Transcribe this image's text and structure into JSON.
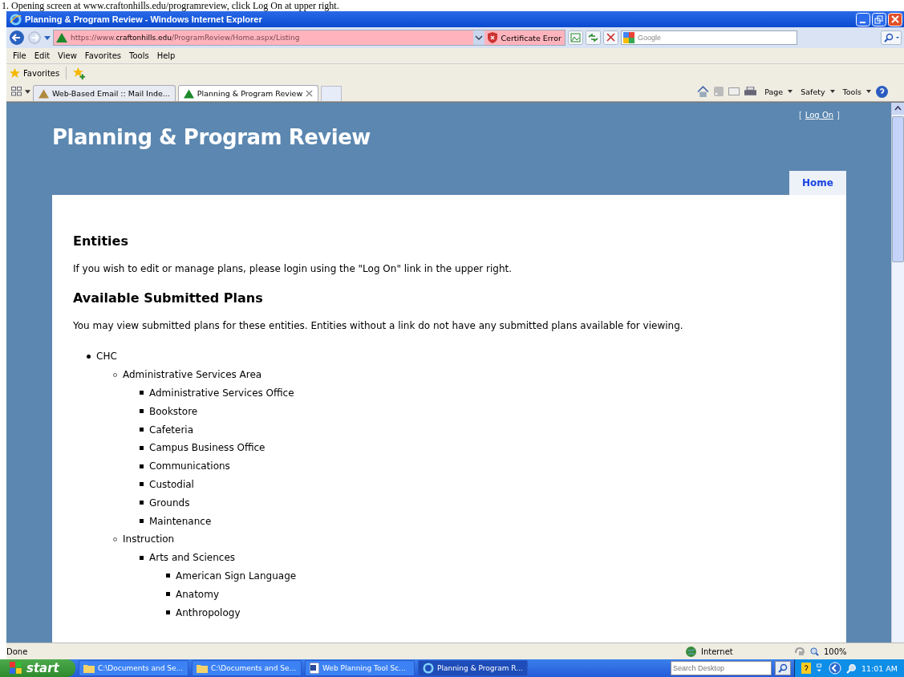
{
  "caption": "1. Opening screen at www.craftonhills.edu/programreview, click Log On at upper right.",
  "window": {
    "title": "Planning & Program Review - Windows Internet Explorer"
  },
  "address_bar": {
    "prefix": "https://www.",
    "domain": "craftonhills.edu",
    "path": "/ProgramReview/Home.aspx/Listing",
    "certificate": "Certificate Error"
  },
  "search": {
    "placeholder": "Google"
  },
  "menu": [
    "File",
    "Edit",
    "View",
    "Favorites",
    "Tools",
    "Help"
  ],
  "favorites_label": "Favorites",
  "tabs": [
    {
      "label": "Web-Based Email :: Mail Inde...",
      "selected": false
    },
    {
      "label": "Planning & Program Review",
      "selected": true
    }
  ],
  "command_bar": [
    "Page",
    "Safety",
    "Tools"
  ],
  "page": {
    "title": "Planning & Program Review",
    "logon": {
      "open": "[",
      "link": "Log On",
      "close": "]"
    },
    "nav": [
      {
        "label": "Home",
        "selected": true
      }
    ],
    "heading": "Entities",
    "intro": "If you wish to edit or manage plans, please login using the \"Log On\" link in the upper right.",
    "subheading": "Available Submitted Plans",
    "note": "You may view submitted plans for these entities. Entities without a link do not have any submitted plans available for viewing.",
    "tree": [
      {
        "label": "CHC",
        "children": [
          {
            "label": "Administrative Services Area",
            "children": [
              {
                "label": "Administrative Services Office"
              },
              {
                "label": "Bookstore"
              },
              {
                "label": "Cafeteria"
              },
              {
                "label": "Campus Business Office"
              },
              {
                "label": "Communications"
              },
              {
                "label": "Custodial"
              },
              {
                "label": "Grounds"
              },
              {
                "label": "Maintenance"
              }
            ]
          },
          {
            "label": "Instruction",
            "children": [
              {
                "label": "Arts and Sciences",
                "children": [
                  {
                    "label": "American Sign Language"
                  },
                  {
                    "label": "Anatomy"
                  },
                  {
                    "label": "Anthropology"
                  }
                ]
              }
            ]
          }
        ]
      }
    ]
  },
  "status_bar": {
    "text": "Done",
    "zone": "Internet",
    "zoom": "100%"
  },
  "taskbar": {
    "start": "start",
    "items": [
      {
        "label": "C:\\Documents and Se...",
        "kind": "folder",
        "selected": false
      },
      {
        "label": "C:\\Documents and Se...",
        "kind": "folder",
        "selected": false
      },
      {
        "label": "Web Planning Tool Sc...",
        "kind": "word",
        "selected": false
      },
      {
        "label": "Planning & Program R...",
        "kind": "ie",
        "selected": true
      }
    ],
    "search_placeholder": "Search Desktop",
    "clock": "11:01 AM"
  }
}
